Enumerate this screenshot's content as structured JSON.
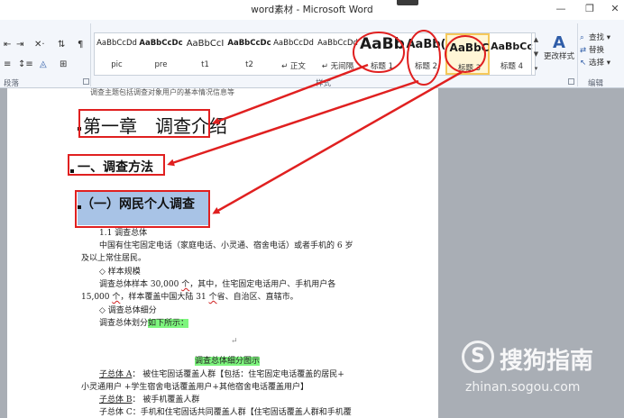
{
  "window": {
    "title": "word素材 - Microsoft Word",
    "controls": [
      "—",
      "❐",
      "✕"
    ]
  },
  "ribbon": {
    "paragraph_group_label": "段落",
    "styles_group_label": "样式",
    "editing_group_label": "编辑",
    "styles": [
      {
        "sample": "AaBbCcDd",
        "name": "pic"
      },
      {
        "sample": "AaBbCcDc",
        "name": "pre"
      },
      {
        "sample": "AaBbCcI",
        "name": "t1"
      },
      {
        "sample": "AaBbCcDc",
        "name": "t2"
      },
      {
        "sample": "AaBbCcDd",
        "name": "↵ 正文"
      },
      {
        "sample": "AaBbCcDd",
        "name": "↵ 无间隔"
      },
      {
        "sample": "AaBb",
        "name": "标题 1"
      },
      {
        "sample": "AaBb(",
        "name": "标题 2"
      },
      {
        "sample": "AaBbC",
        "name": "标题 3"
      },
      {
        "sample": "AaBbCc",
        "name": "标题 4"
      }
    ],
    "change_styles_label": "更改样式",
    "find_label": "查找 ▾",
    "replace_label": "替换",
    "select_label": "选择 ▾"
  },
  "document": {
    "top_line": "调查主题包括调查对象用户的基本情况信息等",
    "chapter_heading": "第一章　调查介绍",
    "section_heading": "一、调查方法",
    "subsection_heading": "（一）网民个人调查",
    "lines": {
      "l1": "1.1  调查总体",
      "l2": "中国有住宅固定电话（家庭电话、小灵通、宿舍电话）或者手机的 6 岁",
      "l3": "及以上常住居民。",
      "l4": "◇  样本规模",
      "l5a": "调查总体样本 30,000 ",
      "l5b": "个",
      "l5c": "，其中，住宅固定电话用户、手机用户各",
      "l6a": "15,000 ",
      "l6b": "个",
      "l6c": "，样本覆盖中国大陆 31 ",
      "l6d": "个",
      "l6e": "省、自治区、直辖市。",
      "l7": "◇  调查总体细分",
      "l8a": "调查总体划分",
      "l8b": "如下所示：",
      "l9": "调查总体细分图示",
      "l10a": "子总体 A",
      "l10b": "：  被住宅固话覆盖人群【包括：住宅固定电话覆盖的居民+",
      "l11": "小灵通用户 +学生宿舍电话覆盖用户+其他宿舍电话覆盖用户】",
      "l12a": "子总体 B",
      "l12b": "：  被手机覆盖人群",
      "l13": "子总体 C：手机和住宅固话共同覆盖人群【住宅固话覆盖人群和手机覆"
    }
  },
  "watermark": {
    "brand": "搜狗指南",
    "url": "zhinan.sogou.com",
    "logo_letter": "S"
  },
  "annotation_color": "#e02020"
}
